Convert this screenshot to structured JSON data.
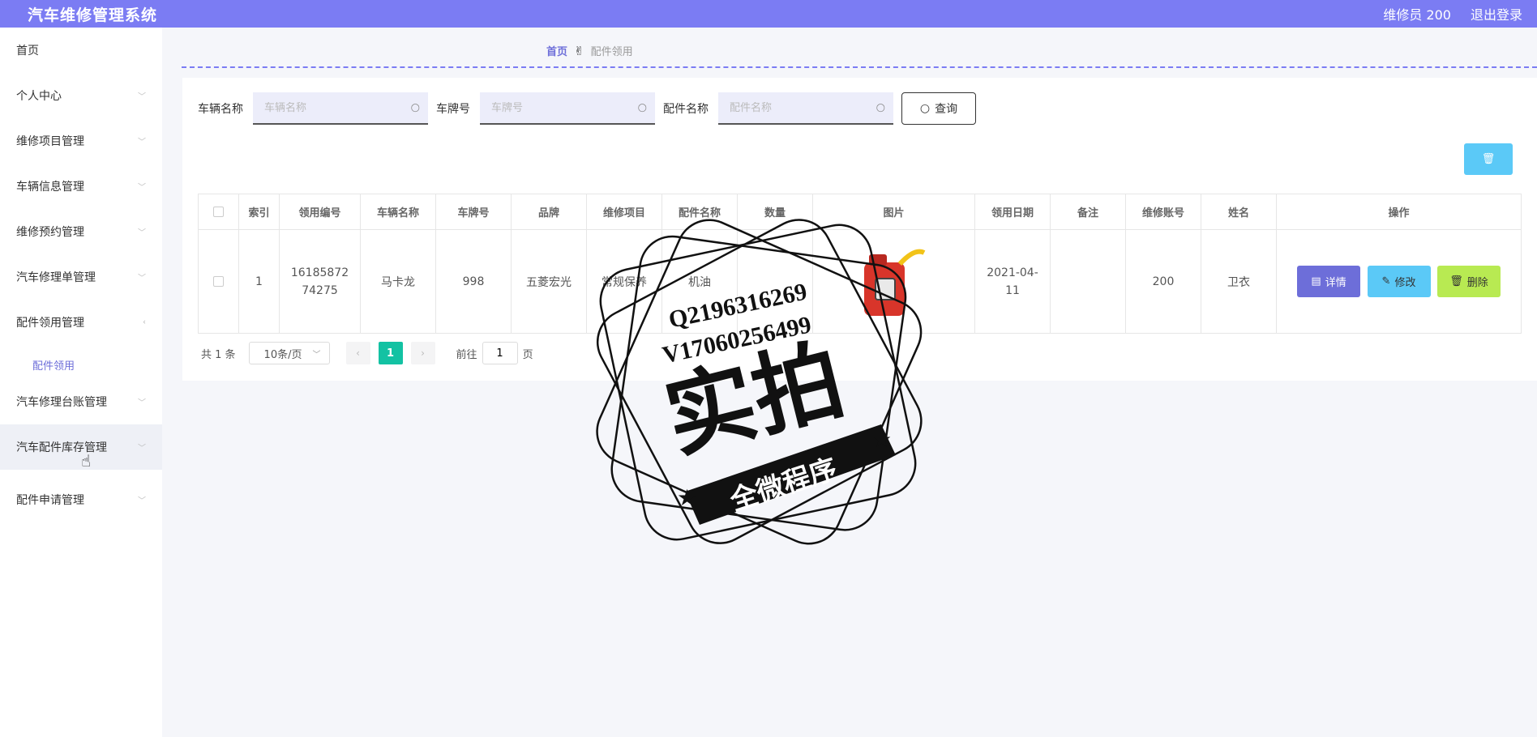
{
  "header": {
    "title": "汽车维修管理系统",
    "user": "维修员 200",
    "logout": "退出登录"
  },
  "sidebar": {
    "items": [
      {
        "label": "首页"
      },
      {
        "label": "个人中心"
      },
      {
        "label": "维修项目管理"
      },
      {
        "label": "车辆信息管理"
      },
      {
        "label": "维修预约管理"
      },
      {
        "label": "汽车修理单管理"
      },
      {
        "label": "配件领用管理"
      },
      {
        "label": "汽车修理台账管理"
      },
      {
        "label": "汽车配件库存管理"
      },
      {
        "label": "配件申请管理"
      }
    ],
    "sub_item": "配件领用"
  },
  "breadcrumb": {
    "home": "首页",
    "current": "配件领用"
  },
  "search": {
    "car_name_label": "车辆名称",
    "car_name_placeholder": "车辆名称",
    "plate_label": "车牌号",
    "plate_placeholder": "车牌号",
    "part_label": "配件名称",
    "part_placeholder": "配件名称",
    "query_label": "查询"
  },
  "table": {
    "columns": [
      "索引",
      "领用编号",
      "车辆名称",
      "车牌号",
      "品牌",
      "维修项目",
      "配件名称",
      "数量",
      "图片",
      "领用日期",
      "备注",
      "维修账号",
      "姓名",
      "操作"
    ],
    "rows": [
      {
        "index": "1",
        "code": "1618587274275",
        "car": "马卡龙",
        "plate": "998",
        "brand": "五菱宏光",
        "project": "常规保养",
        "part": "机油",
        "qty": "",
        "date": "2021-04-11",
        "note": "",
        "account": "200",
        "name": "卫衣"
      }
    ],
    "detail_label": "详情",
    "edit_label": "修改",
    "delete_label": "删除"
  },
  "pager": {
    "total": "共 1 条",
    "page_size": "10条/页",
    "current_page": "1",
    "goto_label": "前往",
    "goto_value": "1",
    "page_unit": "页"
  },
  "watermark": {
    "line1": "Q2196316269",
    "line2": "V17060256499",
    "main": "实拍",
    "banner": "全微程序"
  }
}
